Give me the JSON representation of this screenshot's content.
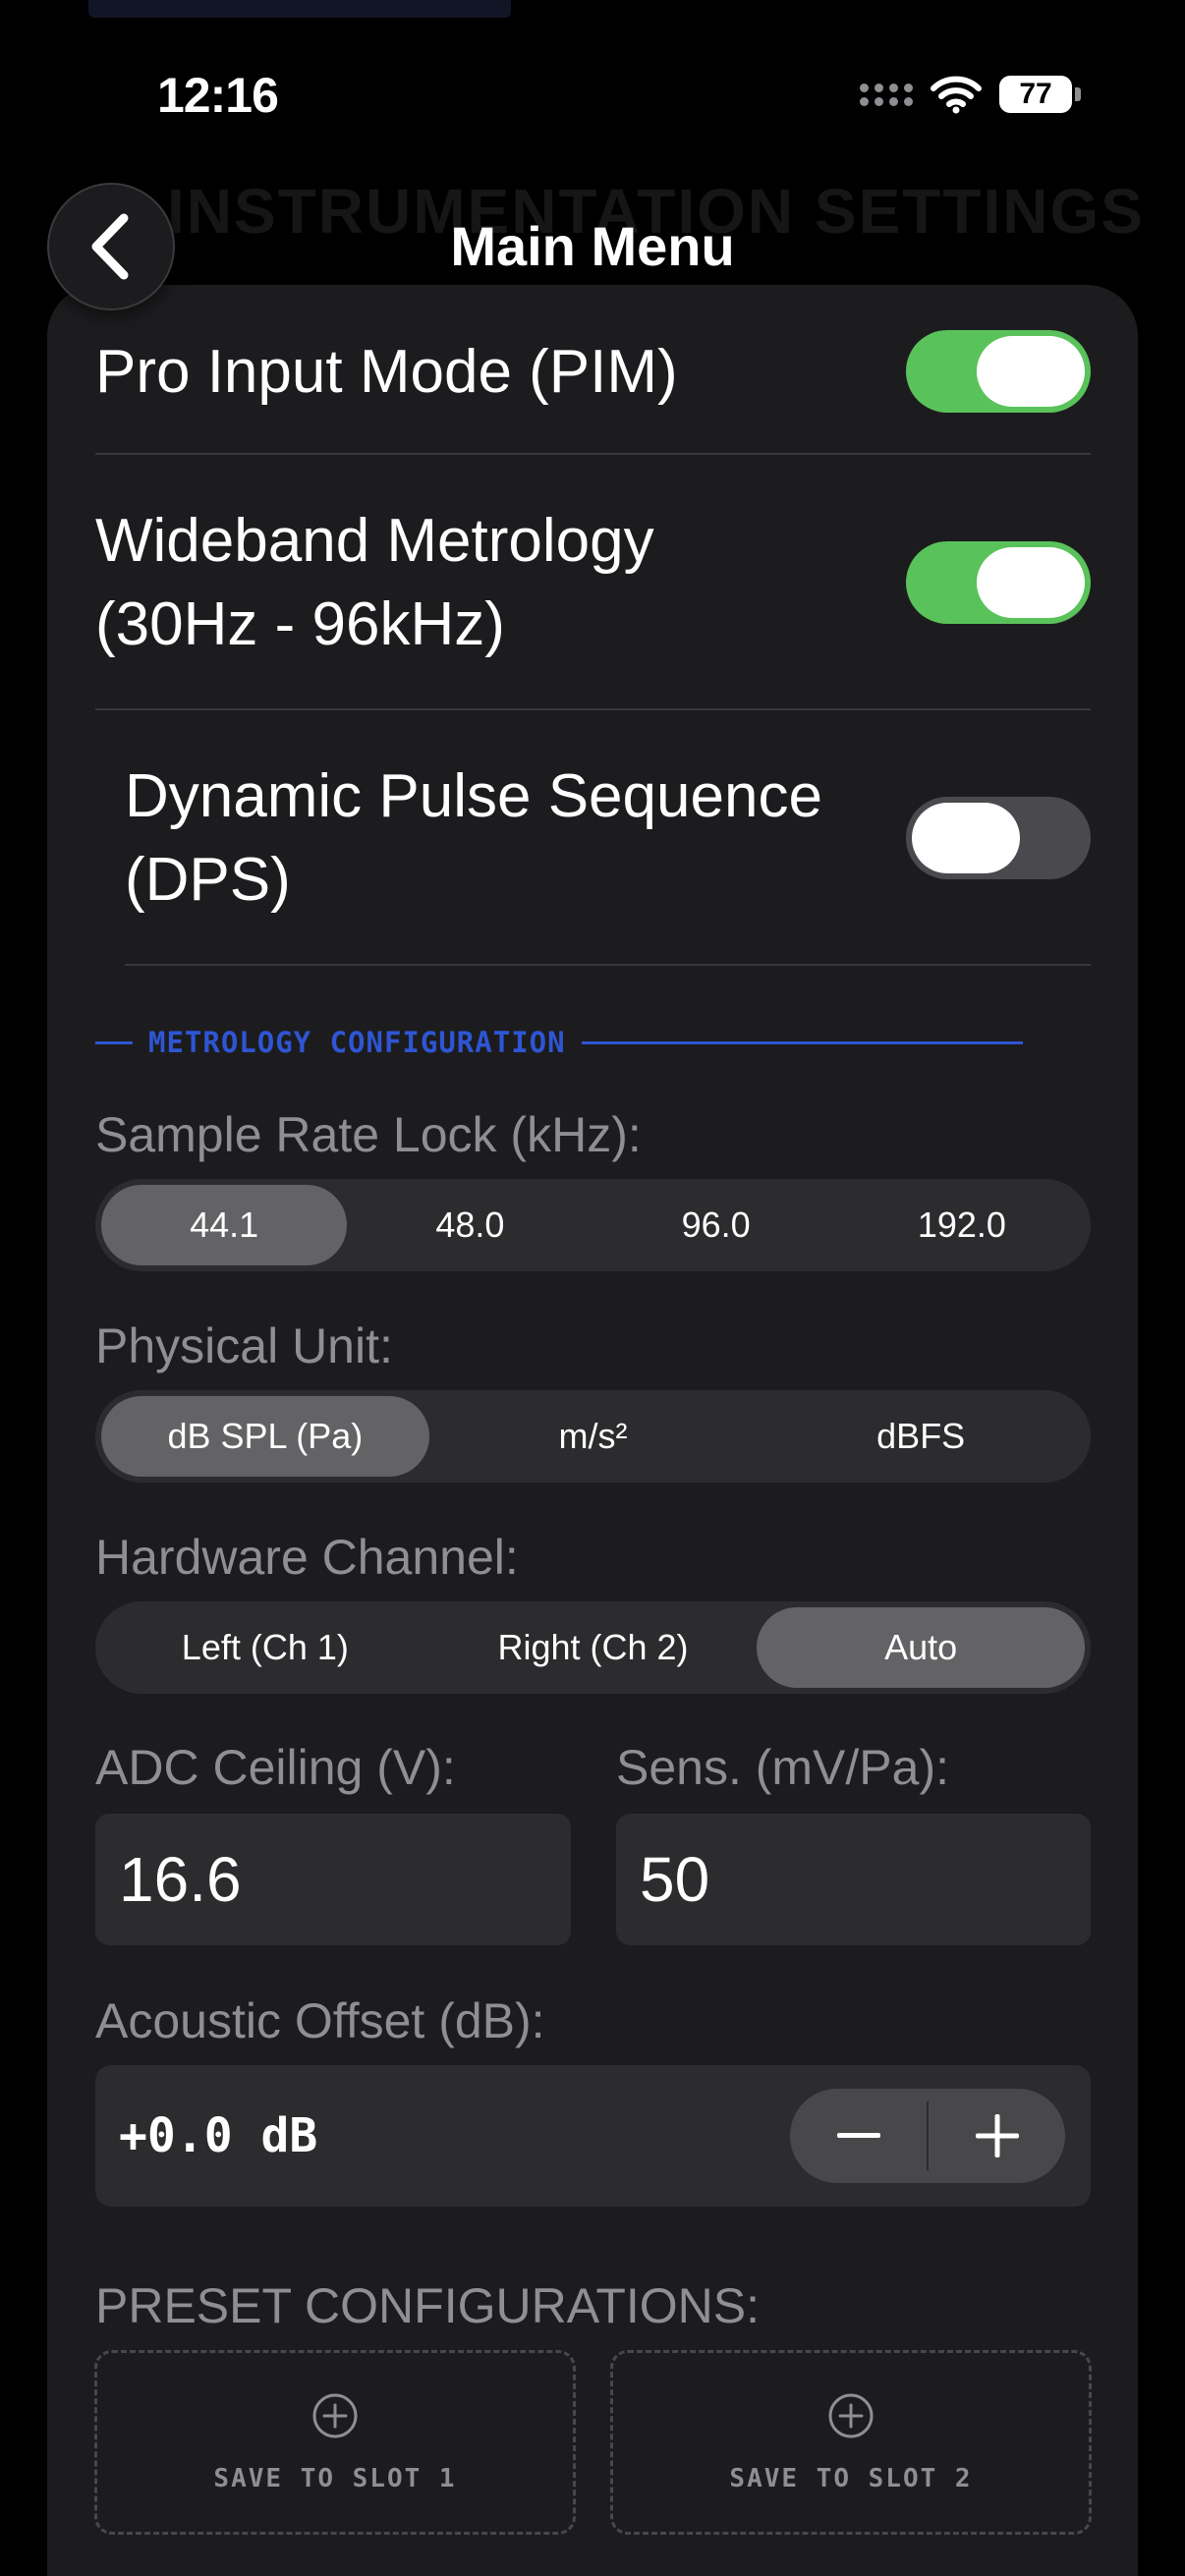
{
  "status_bar": {
    "time": "12:16",
    "battery": "77"
  },
  "background_title": "INSTRUMENTATION SETTINGS",
  "nav": {
    "title": "Main Menu",
    "back_icon": "chevron-left-icon"
  },
  "toggles": [
    {
      "label": "Pro Input Mode (PIM)",
      "on": true
    },
    {
      "label": "Wideband Metrology (30Hz - 96kHz)",
      "on": true
    },
    {
      "label": "Dynamic Pulse Sequence (DPS)",
      "on": false
    }
  ],
  "metrology_section": {
    "title": "METROLOGY CONFIGURATION",
    "accent_color": "#2f55d4"
  },
  "sample_rate": {
    "label": "Sample Rate Lock (kHz):",
    "options": [
      "44.1",
      "48.0",
      "96.0",
      "192.0"
    ],
    "selected": "44.1"
  },
  "physical_unit": {
    "label": "Physical Unit:",
    "options": [
      "dB SPL (Pa)",
      "m/s²",
      "dBFS"
    ],
    "selected": "dB SPL (Pa)"
  },
  "hardware_channel": {
    "label": "Hardware Channel:",
    "options": [
      "Left (Ch 1)",
      "Right (Ch 2)",
      "Auto"
    ],
    "selected": "Auto"
  },
  "adc_ceiling": {
    "label": "ADC Ceiling (V):",
    "value": "16.6"
  },
  "sensitivity": {
    "label": "Sens. (mV/Pa):",
    "value": "50"
  },
  "acoustic_offset": {
    "label": "Acoustic Offset (dB):",
    "value": "+0.0 dB",
    "minus_icon": "minus-icon",
    "plus_icon": "plus-icon"
  },
  "presets": {
    "label": "PRESET CONFIGURATIONS:",
    "slots": [
      {
        "label": "SAVE TO SLOT 1",
        "icon": "plus-circle-icon"
      },
      {
        "label": "SAVE TO SLOT 2",
        "icon": "plus-circle-icon"
      }
    ]
  },
  "colors": {
    "toggle_on": "#5ac25b",
    "background": "#1c1c1e",
    "control": "#2c2c2e"
  }
}
